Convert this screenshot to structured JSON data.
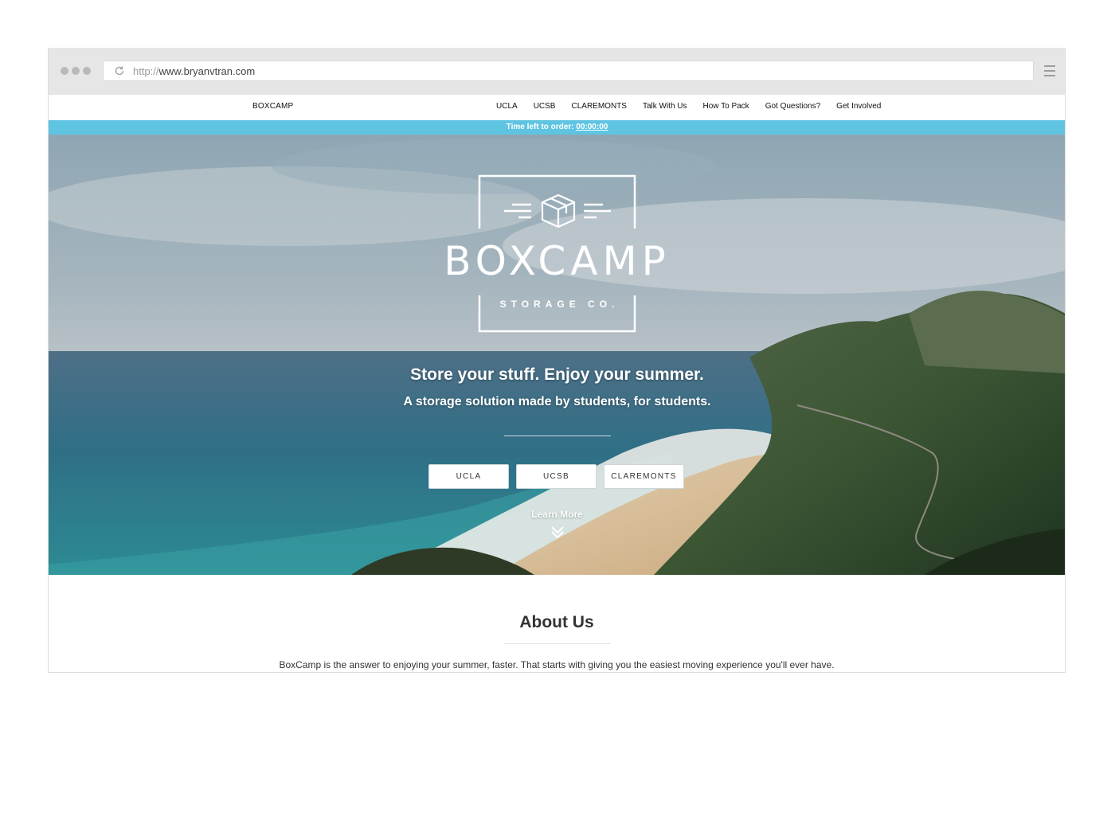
{
  "browser": {
    "url_protocol": "http://",
    "url_host": "www.bryanvtran.com"
  },
  "nav": {
    "brand": "BOXCAMP",
    "links": [
      "UCLA",
      "UCSB",
      "CLAREMONTS",
      "Talk With Us",
      "How To Pack",
      "Got Questions?",
      "Get Involved"
    ]
  },
  "banner": {
    "label": "Time left to order:",
    "countdown": "00:00:00",
    "color": "#5ec4e1"
  },
  "hero": {
    "logo_title": "BOXCAMP",
    "logo_subtitle": "STORAGE CO.",
    "tagline": "Store your stuff. Enjoy your summer.",
    "subtagline": "A storage solution made by students, for students.",
    "buttons": [
      "UCLA",
      "UCSB",
      "CLAREMONTS"
    ],
    "learn_more": "Learn More",
    "logo_icon": "box-icon",
    "scroll_icon": "double-chevron-down-icon"
  },
  "about": {
    "heading": "About Us",
    "text": "BoxCamp is the answer to enjoying your summer, faster. That starts with giving you the easiest moving experience you'll ever have."
  }
}
